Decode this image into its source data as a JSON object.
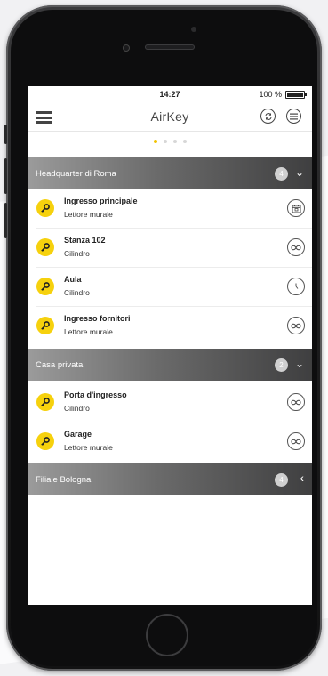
{
  "status_bar": {
    "time": "14:27",
    "battery": "100 %"
  },
  "navbar": {
    "title": "AirKey"
  },
  "pager": {
    "count": 4,
    "active": 0
  },
  "sections": [
    {
      "name": "Headquarter di Roma",
      "count": "4",
      "expanded": true,
      "items": [
        {
          "title": "Ingresso principale",
          "subtitle": "Lettore murale",
          "icon": "calendar-icon"
        },
        {
          "title": "Stanza 102",
          "subtitle": "Cilindro",
          "icon": "infinity-icon"
        },
        {
          "title": "Aula",
          "subtitle": "Cilindro",
          "icon": "clock-icon"
        },
        {
          "title": "Ingresso fornitori",
          "subtitle": "Lettore murale",
          "icon": "infinity-icon"
        }
      ]
    },
    {
      "name": "Casa privata",
      "count": "2",
      "expanded": true,
      "items": [
        {
          "title": "Porta d'ingresso",
          "subtitle": "Cilindro",
          "icon": "infinity-icon"
        },
        {
          "title": "Garage",
          "subtitle": "Lettore murale",
          "icon": "infinity-icon"
        }
      ]
    },
    {
      "name": "Filiale Bologna",
      "count": "4",
      "expanded": false,
      "items": []
    }
  ],
  "colors": {
    "accent": "#f6d10d",
    "header_dark": "#3f3f40",
    "header_light": "#9b9b9b"
  }
}
